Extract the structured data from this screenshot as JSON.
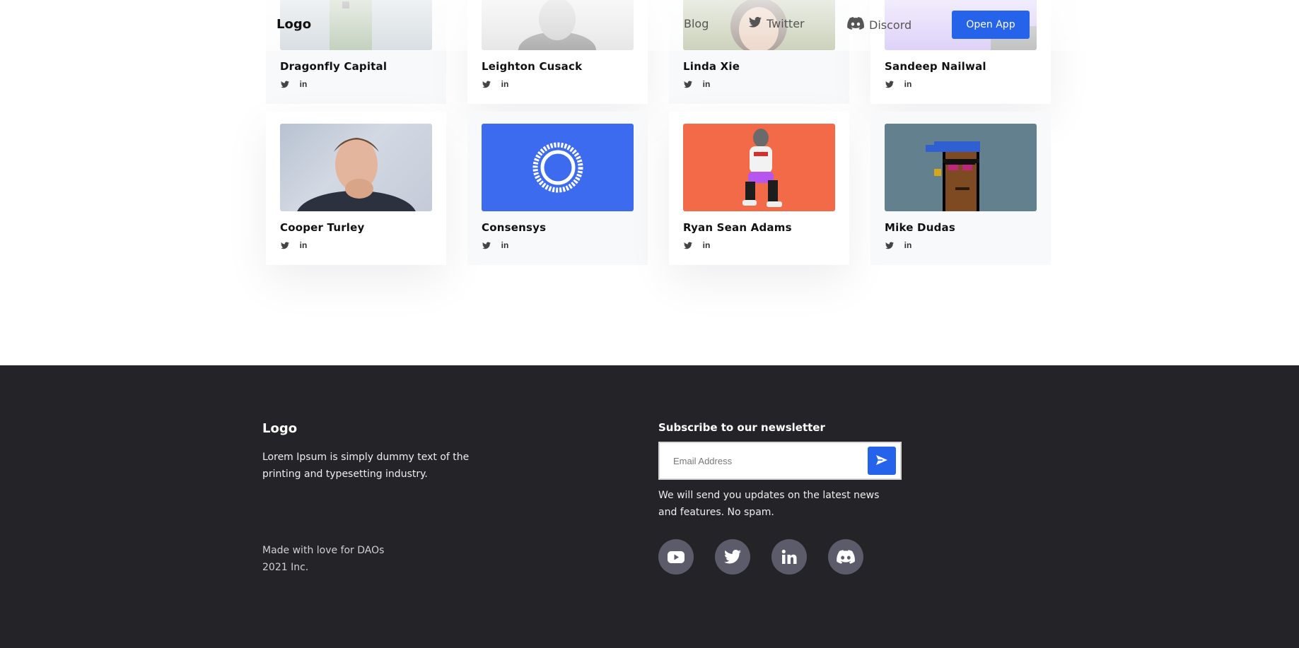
{
  "header": {
    "logo": "Logo",
    "nav": {
      "blog": "Blog",
      "twitter": "Twitter",
      "discord": "Discord"
    },
    "open_app": "Open App"
  },
  "investors": {
    "row1": [
      {
        "name": "Dragonfly Capital",
        "style": "alt",
        "photo": "green-pixel-avatar"
      },
      {
        "name": "Leighton Cusack",
        "style": "plain",
        "photo": "grayscale-portrait"
      },
      {
        "name": "Linda Xie",
        "style": "alt",
        "photo": "woman-portrait"
      },
      {
        "name": "Sandeep Nailwal",
        "style": "plain",
        "photo": "purple-portrait"
      }
    ],
    "row2": [
      {
        "name": "Cooper Turley",
        "style": "plain",
        "photo": "man-portrait"
      },
      {
        "name": "Consensys",
        "style": "alt",
        "photo": "consensys-logo"
      },
      {
        "name": "Ryan Sean Adams",
        "style": "plain",
        "photo": "kneeling-figure"
      },
      {
        "name": "Mike Dudas",
        "style": "alt",
        "photo": "pixel-punk-avatar"
      }
    ],
    "social_icons": [
      "twitter-icon",
      "linkedin-icon"
    ],
    "linkedin_glyph": "in"
  },
  "footer": {
    "logo": "Logo",
    "description": "Lorem Ipsum is simply dummy text of the printing and typesetting industry.",
    "made_line1": "Made with love for DAOs",
    "made_line2": "2021 Inc.",
    "newsletter_title": "Subscribe to our newsletter",
    "email_placeholder": "Email Address",
    "email_value": "",
    "note": "We will send you updates on the latest news and features. No spam.",
    "socials": [
      "youtube-icon",
      "twitter-icon",
      "linkedin-icon",
      "discord-icon"
    ]
  },
  "colors": {
    "accent": "#2563eb",
    "footer_bg": "#242428",
    "social_circle": "#5c5b6a"
  }
}
